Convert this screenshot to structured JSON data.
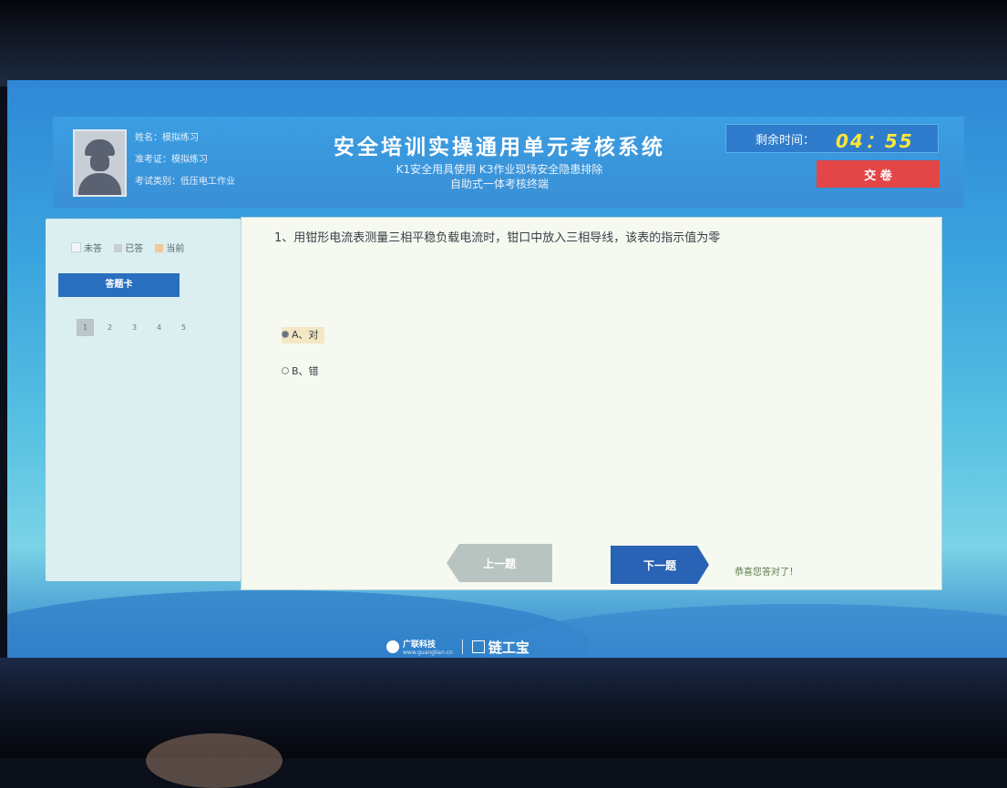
{
  "header": {
    "user": {
      "name": "姓名：模拟练习",
      "ticket": "准考证：模拟练习",
      "category": "考试类别：低压电工作业"
    },
    "title": "安全培训实操通用单元考核系统",
    "subtitle_line1": "K1安全用具使用 K3作业现场安全隐患排除",
    "subtitle_line2": "自助式一体考核终端",
    "timer_label": "剩余时间：",
    "timer_value": "04：55",
    "submit_label": "交 卷"
  },
  "sidebar": {
    "legend": {
      "unanswered": "未答",
      "answered": "已答",
      "current": "当前"
    },
    "legend_colors": {
      "unanswered": "#f3f6f6",
      "answered": "#c6d0d0",
      "current": "#f2c79a"
    },
    "card_tab_label": "答题卡",
    "question_numbers": [
      "1",
      "2",
      "3",
      "4",
      "5"
    ]
  },
  "question": {
    "text": "1、用钳形电流表测量三相平稳负载电流时，钳口中放入三相导线，该表的指示值为零",
    "options": [
      {
        "label": "A、对",
        "selected": true
      },
      {
        "label": "B、错",
        "selected": false
      }
    ]
  },
  "nav": {
    "prev_label": "上一题",
    "next_label": "下一题",
    "feedback": "恭喜您答对了！"
  },
  "footer": {
    "brand1_name": "广联科技",
    "brand1_url": "www.guanglian.cn",
    "brand2_name": "链工宝"
  }
}
